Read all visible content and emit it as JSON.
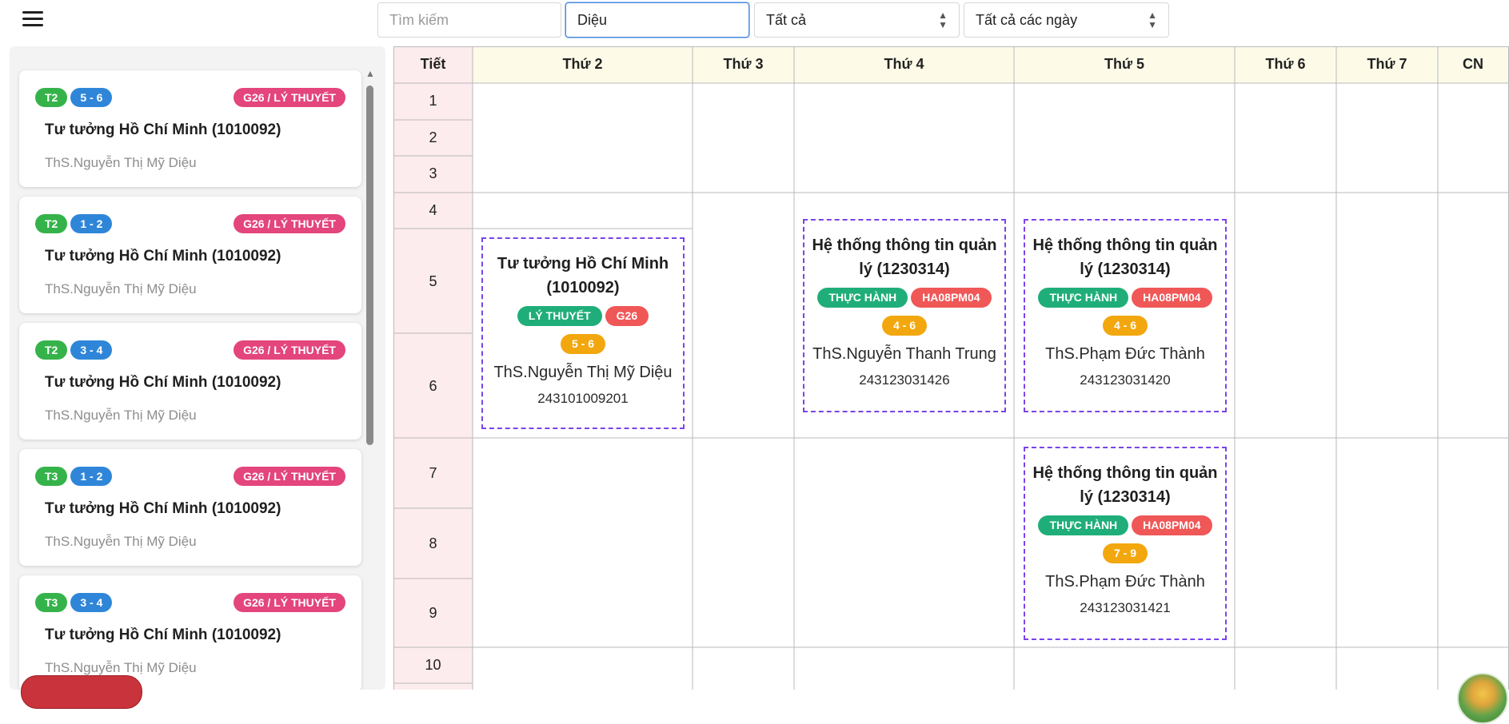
{
  "header": {
    "search_placeholder": "Tìm kiếm",
    "name_value": "Diệu",
    "type_select": "Tất cả",
    "day_select": "Tất cả các ngày"
  },
  "sidebar": {
    "cards": [
      {
        "day": "T2",
        "period": "5 - 6",
        "room": "G26 / LÝ THUYẾT",
        "title": "Tư tưởng Hồ Chí Minh (1010092)",
        "teacher": "ThS.Nguyễn Thị Mỹ Diệu"
      },
      {
        "day": "T2",
        "period": "1 - 2",
        "room": "G26 / LÝ THUYẾT",
        "title": "Tư tưởng Hồ Chí Minh (1010092)",
        "teacher": "ThS.Nguyễn Thị Mỹ Diệu"
      },
      {
        "day": "T2",
        "period": "3 - 4",
        "room": "G26 / LÝ THUYẾT",
        "title": "Tư tưởng Hồ Chí Minh (1010092)",
        "teacher": "ThS.Nguyễn Thị Mỹ Diệu"
      },
      {
        "day": "T3",
        "period": "1 - 2",
        "room": "G26 / LÝ THUYẾT",
        "title": "Tư tưởng Hồ Chí Minh (1010092)",
        "teacher": "ThS.Nguyễn Thị Mỹ Diệu"
      },
      {
        "day": "T3",
        "period": "3 - 4",
        "room": "G26 / LÝ THUYẾT",
        "title": "Tư tưởng Hồ Chí Minh (1010092)",
        "teacher": "ThS.Nguyễn Thị Mỹ Diệu"
      }
    ]
  },
  "timetable": {
    "headers": [
      "Tiết",
      "Thứ 2",
      "Thứ 3",
      "Thứ 4",
      "Thứ 5",
      "Thứ 6",
      "Thứ 7",
      "CN"
    ],
    "periods": [
      "1",
      "2",
      "3",
      "4",
      "5",
      "6",
      "7",
      "8",
      "9",
      "10"
    ],
    "events": [
      {
        "title": "Tư tưởng Hồ Chí Minh (1010092)",
        "kind": "LÝ THUYẾT",
        "room": "G26",
        "periods": "5 - 6",
        "teacher": "ThS.Nguyễn Thị Mỹ Diệu",
        "code": "243101009201"
      },
      {
        "title": "Hệ thống thông tin quản lý (1230314)",
        "kind": "THỰC HÀNH",
        "room": "HA08PM04",
        "periods": "4 - 6",
        "teacher": "ThS.Nguyễn Thanh Trung",
        "code": "243123031426"
      },
      {
        "title": "Hệ thống thông tin quản lý (1230314)",
        "kind": "THỰC HÀNH",
        "room": "HA08PM04",
        "periods": "4 - 6",
        "teacher": "ThS.Phạm Đức Thành",
        "code": "243123031420"
      },
      {
        "title": "Hệ thống thông tin quản lý (1230314)",
        "kind": "THỰC HÀNH",
        "room": "HA08PM04",
        "periods": "7 - 9",
        "teacher": "ThS.Phạm Đức Thành",
        "code": "243123031421"
      }
    ]
  },
  "colors": {
    "header_bg": "#fdfbe8",
    "period_bg": "#fdeced",
    "grid_line": "#b9b9bd",
    "event_border": "#7a44e6",
    "day_badge": "#35b34a",
    "period_badge": "#2f86d8",
    "room_badge": "#e3457c",
    "kind_tag": "#1fae7a",
    "room_tag": "#f05757",
    "periods_tag": "#f3a70e"
  }
}
